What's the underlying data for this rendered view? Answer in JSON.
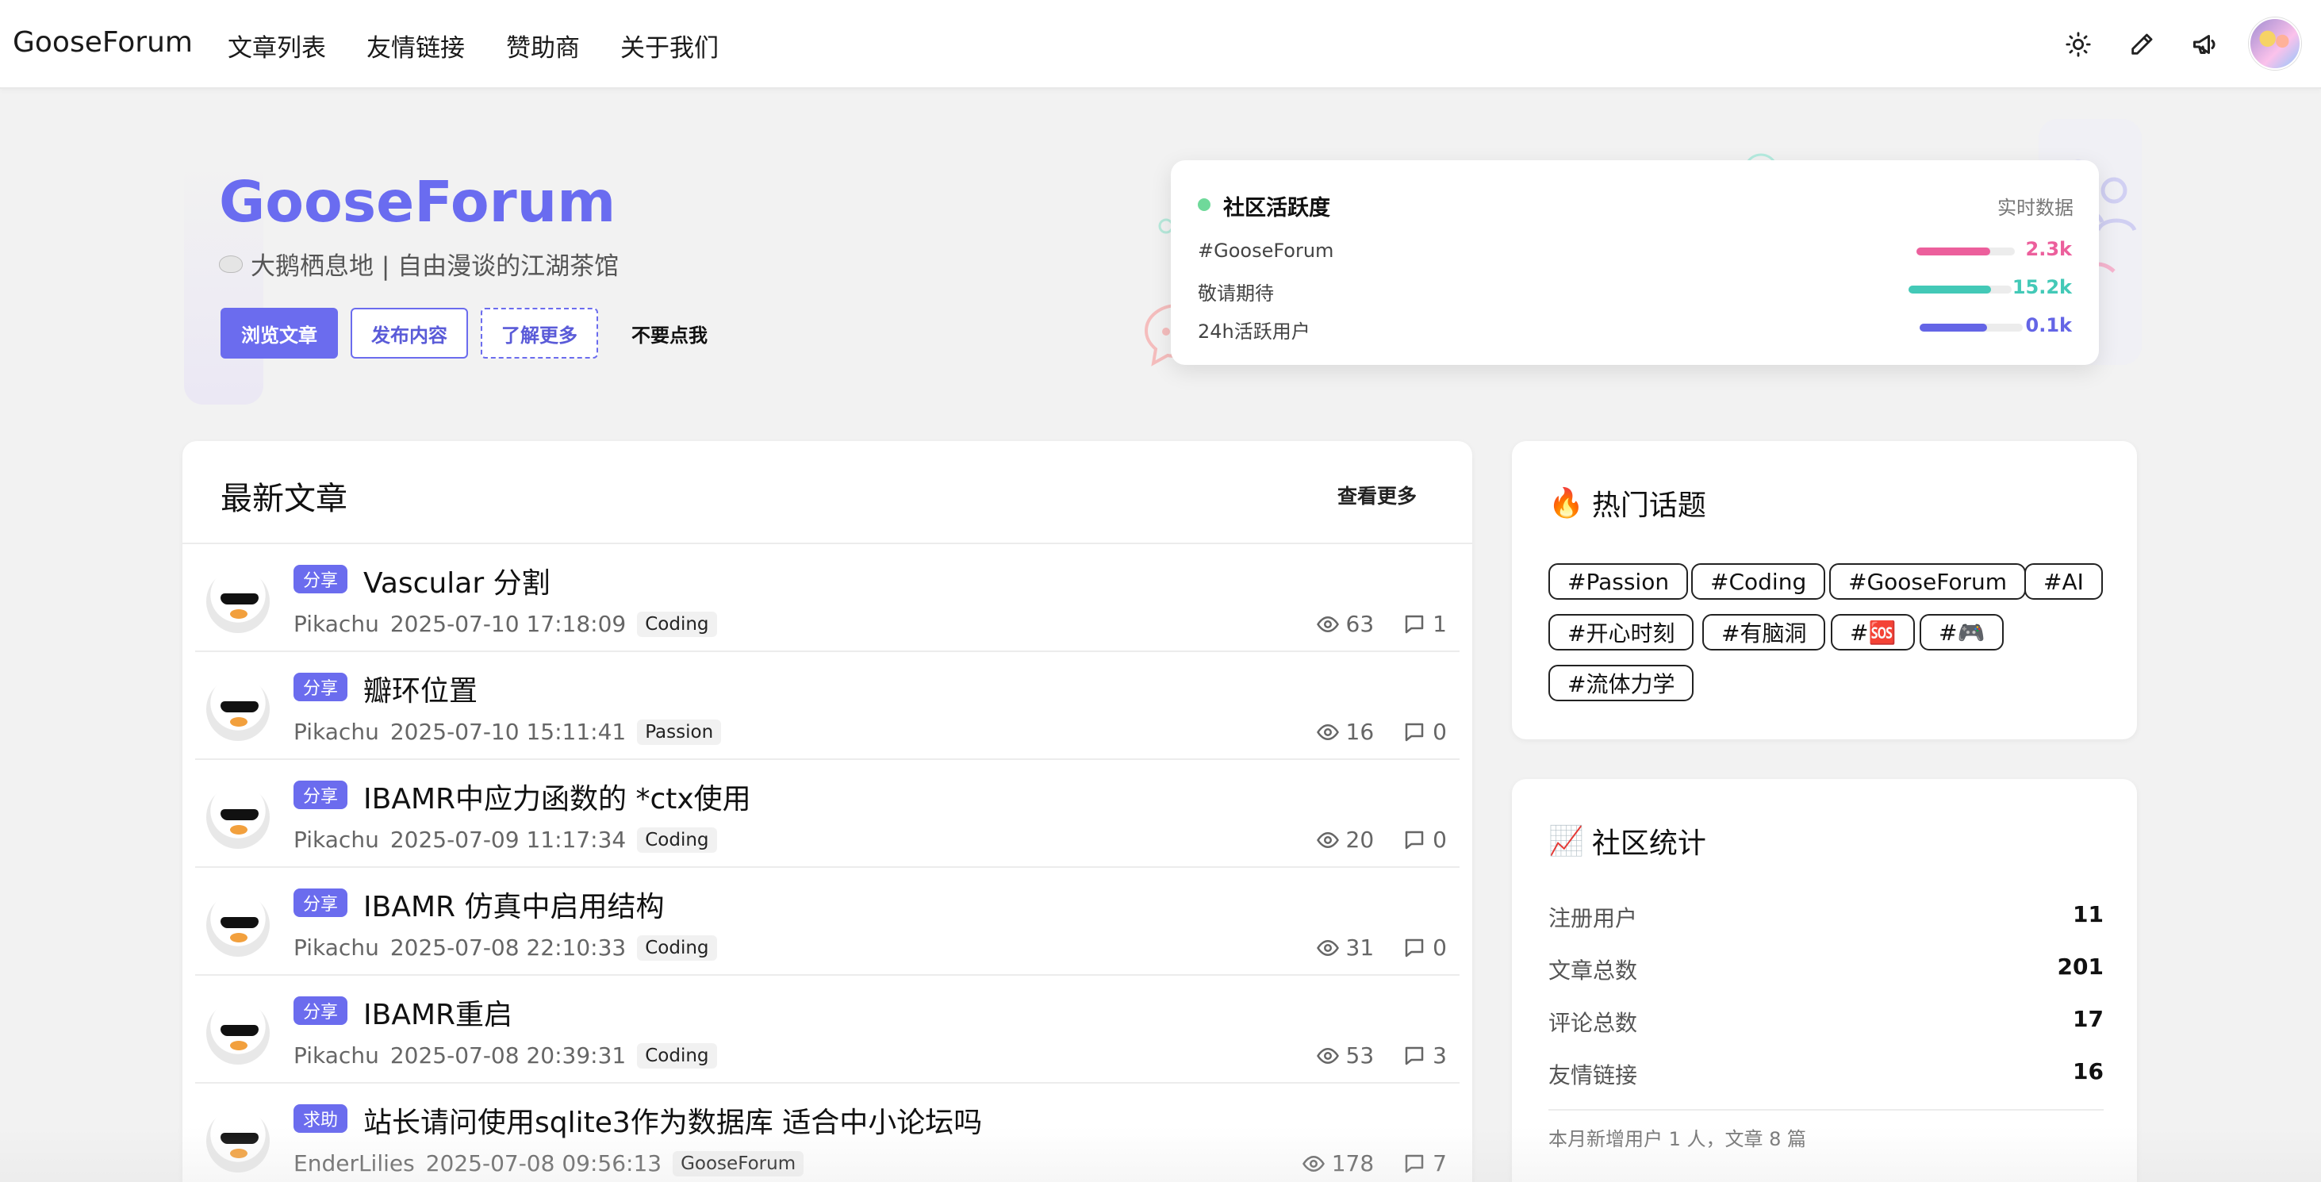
{
  "nav": {
    "brand": "GooseForum",
    "links": [
      "文章列表",
      "友情链接",
      "赞助商",
      "关于我们"
    ],
    "icons": [
      "sun-icon",
      "pencil-icon",
      "megaphone-icon"
    ]
  },
  "hero": {
    "title": "GooseForum",
    "subtitle": "大鹅栖息地 | 自由漫谈的江湖茶馆",
    "buttons": {
      "browse": "浏览文章",
      "publish": "发布内容",
      "learn": "了解更多",
      "dont_click": "不要点我"
    }
  },
  "activity": {
    "title": "社区活跃度",
    "live": "实时数据",
    "rows": [
      {
        "label": "#GooseForum",
        "value": "2.3k",
        "fill": 0.75,
        "color": "#ec5f9c"
      },
      {
        "label": "敬请期待",
        "value": "15.2k",
        "fill": 0.8,
        "color": "#43c9b7"
      },
      {
        "label": "24h活跃用户",
        "value": "0.1k",
        "fill": 0.65,
        "color": "#6465e6"
      }
    ]
  },
  "latest": {
    "title": "最新文章",
    "more": "查看更多",
    "posts": [
      {
        "badge": "分享",
        "title": "Vascular 分割",
        "author": "Pikachu",
        "time": "2025-07-10 17:18:09",
        "tag": "Coding",
        "views": "63",
        "comments": "1"
      },
      {
        "badge": "分享",
        "title": "瓣环位置",
        "author": "Pikachu",
        "time": "2025-07-10 15:11:41",
        "tag": "Passion",
        "views": "16",
        "comments": "0"
      },
      {
        "badge": "分享",
        "title": "IBAMR中应力函数的 *ctx使用",
        "author": "Pikachu",
        "time": "2025-07-09 11:17:34",
        "tag": "Coding",
        "views": "20",
        "comments": "0"
      },
      {
        "badge": "分享",
        "title": "IBAMR 仿真中启用结构",
        "author": "Pikachu",
        "time": "2025-07-08 22:10:33",
        "tag": "Coding",
        "views": "31",
        "comments": "0"
      },
      {
        "badge": "分享",
        "title": "IBAMR重启",
        "author": "Pikachu",
        "time": "2025-07-08 20:39:31",
        "tag": "Coding",
        "views": "53",
        "comments": "3"
      },
      {
        "badge": "求助",
        "title": "站长请问使用sqlite3作为数据库 适合中小论坛吗",
        "author": "EnderLilies",
        "time": "2025-07-08 09:56:13",
        "tag": "GooseForum",
        "views": "178",
        "comments": "7"
      }
    ]
  },
  "hot_topics": {
    "emoji": "🔥",
    "title": "热门话题",
    "topics": [
      "#Passion",
      "#Coding",
      "#GooseForum",
      "#AI",
      "#开心时刻",
      "#有脑洞",
      "#🆘",
      "#🎮",
      "#流体力学"
    ]
  },
  "community_stats": {
    "emoji": "📈",
    "title": "社区统计",
    "rows": [
      {
        "label": "注册用户",
        "value": "11"
      },
      {
        "label": "文章总数",
        "value": "201"
      },
      {
        "label": "评论总数",
        "value": "17"
      },
      {
        "label": "友情链接",
        "value": "16"
      }
    ],
    "footer": "本月新增用户 1 人，文章 8 篇"
  }
}
